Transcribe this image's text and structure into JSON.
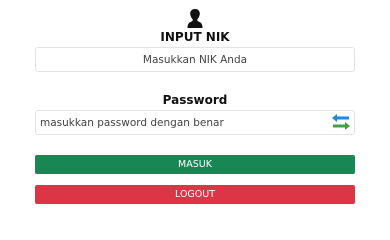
{
  "icons": {
    "user": "user-silhouette-icon",
    "toggle_password": "swap-arrows-icon"
  },
  "nik": {
    "label": "INPUT NIK",
    "placeholder": "Masukkan NIK Anda",
    "value": ""
  },
  "password": {
    "label": "Password",
    "placeholder": "masukkan password dengan benar",
    "value": ""
  },
  "buttons": {
    "masuk": "MASUK",
    "logout": "LOGOUT"
  },
  "colors": {
    "masuk": "#198754",
    "logout": "#dc3545",
    "arrow_blue": "#1e88e5",
    "arrow_green": "#43a047"
  }
}
